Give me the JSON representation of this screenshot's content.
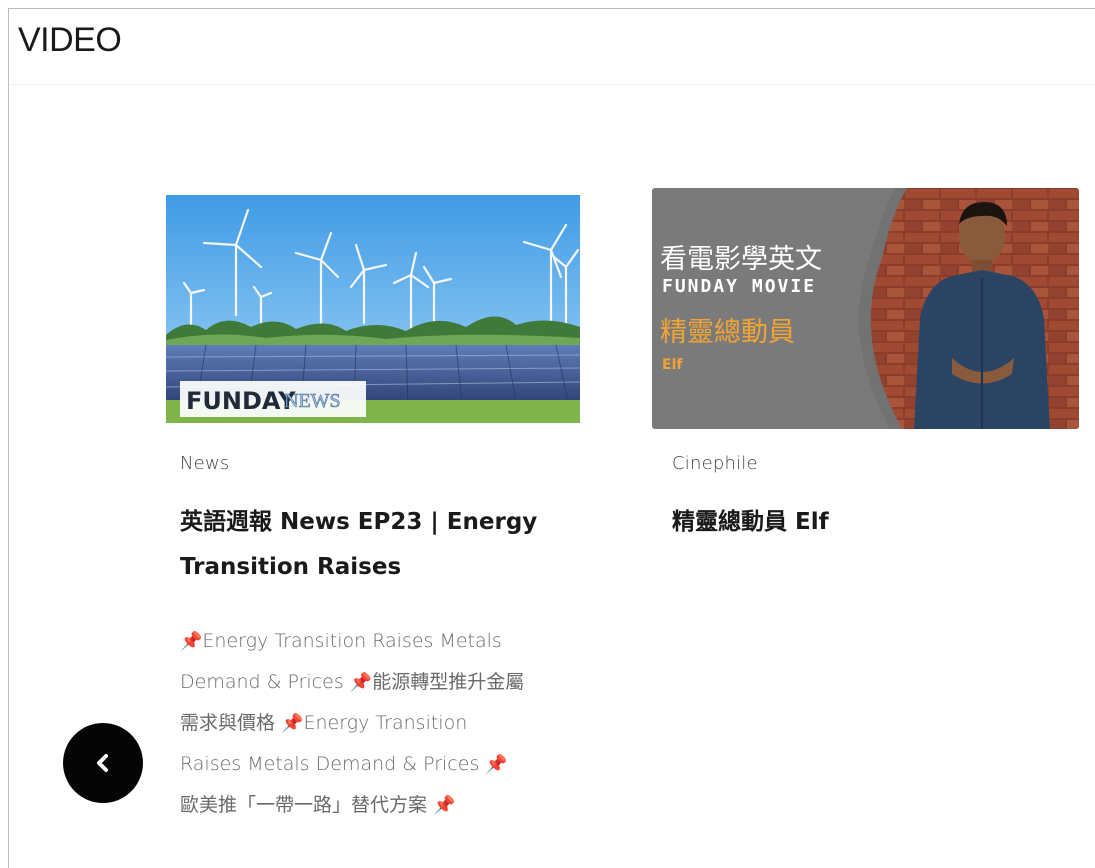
{
  "section": {
    "title": "VIDEO"
  },
  "cards": [
    {
      "category": "News",
      "title": "英語週報 News EP23 | Energy Transition Raises",
      "thumbnail": {
        "brand_text_1": "FUNDAY",
        "brand_text_2": "NEWS"
      },
      "excerpt": [
        {
          "type": "pin"
        },
        {
          "type": "text",
          "value": "Energy Transition Raises Metals Demand & Prices "
        },
        {
          "type": "pin"
        },
        {
          "type": "text",
          "value": "能源轉型推升金屬需求與價格 "
        },
        {
          "type": "pin"
        },
        {
          "type": "text",
          "value": "Energy Transition Raises Metals Demand & Prices "
        },
        {
          "type": "pin"
        },
        {
          "type": "text",
          "value": "歐美推「一帶一路」替代方案 "
        },
        {
          "type": "pin"
        }
      ]
    },
    {
      "category": "Cinephile",
      "title": "精靈總動員 Elf",
      "thumbnail": {
        "line1": "看電影學英文",
        "line2": "FUNDAY MOVIE",
        "line3": "精靈總動員",
        "line4": "Elf"
      }
    }
  ],
  "nav": {
    "prev_icon": "chevron-left-icon"
  },
  "colors": {
    "pin": "#d9362b",
    "accent_orange": "#f2a533",
    "button": "#050505"
  }
}
